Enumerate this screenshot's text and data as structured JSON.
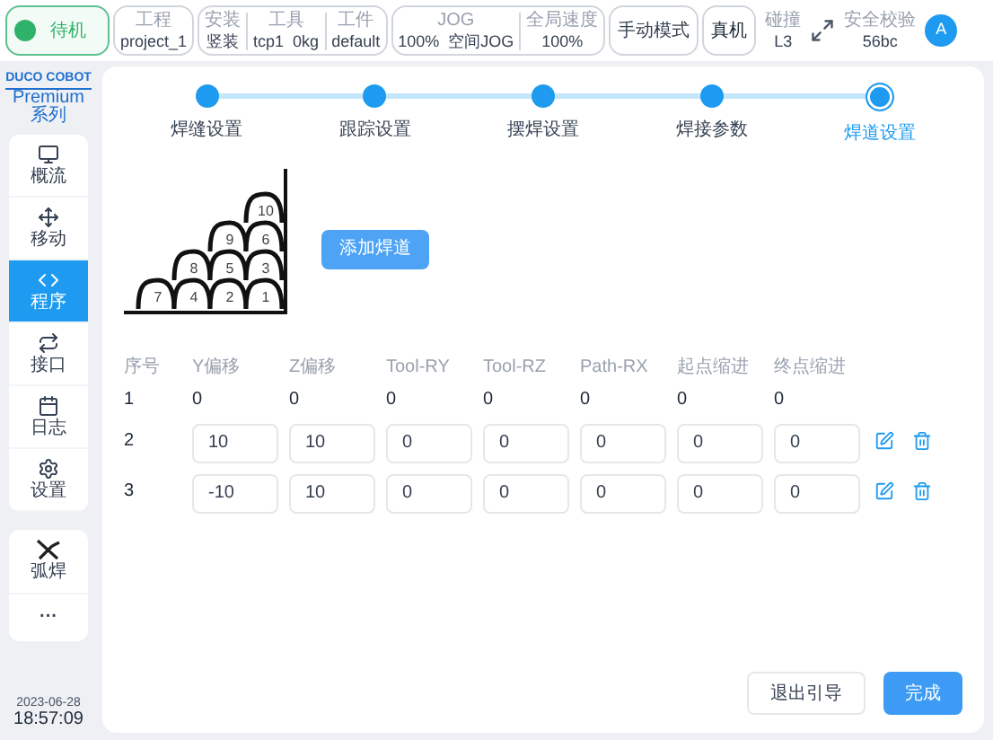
{
  "top_bar": {
    "status": {
      "label": "待机",
      "on": true
    },
    "project": {
      "label": "工程",
      "value": "project_1"
    },
    "install_group": [
      {
        "label": "安装",
        "value": "竖装"
      },
      {
        "label": "工具",
        "value": "tcp1  0kg"
      },
      {
        "label": "工件",
        "value": "default"
      }
    ],
    "jog_group": [
      {
        "label": "JOG",
        "value": "100%  空间JOG"
      },
      {
        "label": "全局速度",
        "value": "100%"
      }
    ],
    "mode_button": "手动模式",
    "robot_button": "真机",
    "collision": {
      "label": "碰撞",
      "value": "L3"
    },
    "safety": {
      "label": "安全校验",
      "value": "56bc"
    },
    "avatar": "A"
  },
  "sidebar": {
    "logo": "DUCO COBOT",
    "logo_sub": "Premium 系列",
    "items": [
      {
        "label": "概流",
        "selected": false
      },
      {
        "label": "移动",
        "selected": false
      },
      {
        "label": "程序",
        "selected": true
      },
      {
        "label": "接口",
        "selected": false
      },
      {
        "label": "日志",
        "selected": false
      },
      {
        "label": "设置",
        "selected": false
      }
    ],
    "extra_items": [
      {
        "label": "弧焊",
        "kind": "weld"
      },
      {
        "label": "···",
        "kind": "more"
      }
    ],
    "date": "2023-06-28",
    "time": "18:57:09"
  },
  "steps": [
    {
      "label": "焊缝设置",
      "selected": false
    },
    {
      "label": "跟踪设置",
      "selected": false
    },
    {
      "label": "摆焊设置",
      "selected": false
    },
    {
      "label": "焊接参数",
      "selected": false
    },
    {
      "label": "焊道设置",
      "selected": true
    }
  ],
  "bead_labels": [
    "10",
    "9",
    "6",
    "8",
    "5",
    "3",
    "7",
    "4",
    "2",
    "1"
  ],
  "add_bead_button": "添加焊道",
  "table": {
    "columns": [
      "序号",
      "Y偏移",
      "Z偏移",
      "Tool-RY",
      "Tool-RZ",
      "Path-RX",
      "起点缩进",
      "终点缩进"
    ],
    "rows": [
      {
        "kind": "plain",
        "cells": [
          "1",
          "0",
          "0",
          "0",
          "0",
          "0",
          "0",
          "0"
        ]
      },
      {
        "kind": "editable",
        "cells": [
          "2",
          "10",
          "10",
          "0",
          "0",
          "0",
          "0",
          "0"
        ]
      },
      {
        "kind": "editable",
        "cells": [
          "3",
          "-10",
          "10",
          "0",
          "0",
          "0",
          "0",
          "0"
        ]
      }
    ]
  },
  "footer_buttons": [
    {
      "label": "退出引导",
      "kind": "secondary"
    },
    {
      "label": "完成",
      "kind": "primary"
    }
  ]
}
